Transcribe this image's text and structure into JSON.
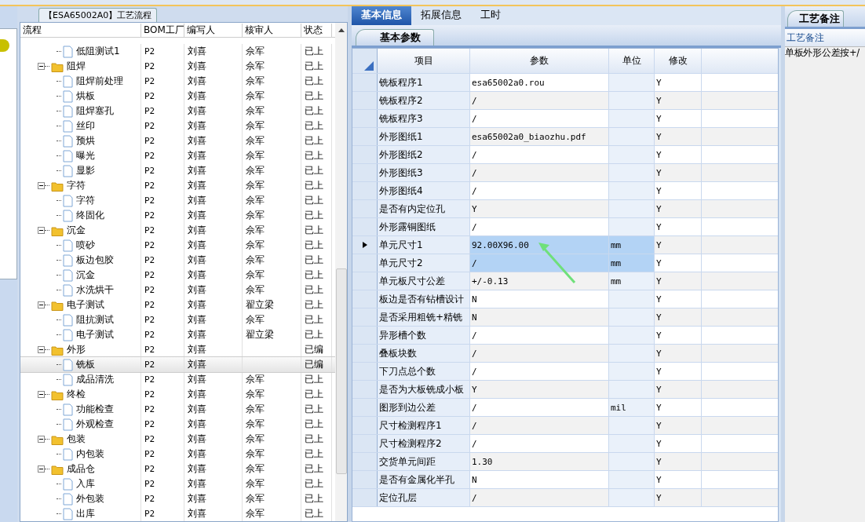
{
  "flow_panel": {
    "title": "【ESA65002A0】工艺流程",
    "columns": [
      "流程",
      "BOM工厂",
      "编写人",
      "核审人",
      "状态"
    ],
    "rows": [
      {
        "kind": "leaf",
        "name": "低阻测试1",
        "factory": "P2",
        "author": "刘喜",
        "reviewer": "佘军",
        "status": "已上",
        "selected": false
      },
      {
        "kind": "group",
        "name": "阻焊",
        "factory": "P2",
        "author": "刘喜",
        "reviewer": "佘军",
        "status": "已上",
        "selected": false,
        "expanded": true,
        "children": [
          {
            "kind": "leaf",
            "name": "阻焊前处理",
            "factory": "P2",
            "author": "刘喜",
            "reviewer": "佘军",
            "status": "已上",
            "selected": false
          },
          {
            "kind": "leaf",
            "name": "烘板",
            "factory": "P2",
            "author": "刘喜",
            "reviewer": "佘军",
            "status": "已上",
            "selected": false
          },
          {
            "kind": "leaf",
            "name": "阻焊塞孔",
            "factory": "P2",
            "author": "刘喜",
            "reviewer": "佘军",
            "status": "已上",
            "selected": false
          },
          {
            "kind": "leaf",
            "name": "丝印",
            "factory": "P2",
            "author": "刘喜",
            "reviewer": "佘军",
            "status": "已上",
            "selected": false
          },
          {
            "kind": "leaf",
            "name": "预烘",
            "factory": "P2",
            "author": "刘喜",
            "reviewer": "佘军",
            "status": "已上",
            "selected": false
          },
          {
            "kind": "leaf",
            "name": "曝光",
            "factory": "P2",
            "author": "刘喜",
            "reviewer": "佘军",
            "status": "已上",
            "selected": false
          },
          {
            "kind": "leaf",
            "name": "显影",
            "factory": "P2",
            "author": "刘喜",
            "reviewer": "佘军",
            "status": "已上",
            "selected": false
          }
        ]
      },
      {
        "kind": "group",
        "name": "字符",
        "factory": "P2",
        "author": "刘喜",
        "reviewer": "佘军",
        "status": "已上",
        "selected": false,
        "expanded": true,
        "children": [
          {
            "kind": "leaf",
            "name": "字符",
            "factory": "P2",
            "author": "刘喜",
            "reviewer": "佘军",
            "status": "已上",
            "selected": false
          },
          {
            "kind": "leaf",
            "name": "终固化",
            "factory": "P2",
            "author": "刘喜",
            "reviewer": "佘军",
            "status": "已上",
            "selected": false
          }
        ]
      },
      {
        "kind": "group",
        "name": "沉金",
        "factory": "P2",
        "author": "刘喜",
        "reviewer": "佘军",
        "status": "已上",
        "selected": false,
        "expanded": true,
        "children": [
          {
            "kind": "leaf",
            "name": "喷砂",
            "factory": "P2",
            "author": "刘喜",
            "reviewer": "佘军",
            "status": "已上",
            "selected": false
          },
          {
            "kind": "leaf",
            "name": "板边包胶",
            "factory": "P2",
            "author": "刘喜",
            "reviewer": "佘军",
            "status": "已上",
            "selected": false
          },
          {
            "kind": "leaf",
            "name": "沉金",
            "factory": "P2",
            "author": "刘喜",
            "reviewer": "佘军",
            "status": "已上",
            "selected": false
          },
          {
            "kind": "leaf",
            "name": "水洗烘干",
            "factory": "P2",
            "author": "刘喜",
            "reviewer": "佘军",
            "status": "已上",
            "selected": false
          }
        ]
      },
      {
        "kind": "group",
        "name": "电子测试",
        "factory": "P2",
        "author": "刘喜",
        "reviewer": "翟立梁",
        "status": "已上",
        "selected": false,
        "expanded": true,
        "children": [
          {
            "kind": "leaf",
            "name": "阻抗测试",
            "factory": "P2",
            "author": "刘喜",
            "reviewer": "佘军",
            "status": "已上",
            "selected": false
          },
          {
            "kind": "leaf",
            "name": "电子测试",
            "factory": "P2",
            "author": "刘喜",
            "reviewer": "翟立梁",
            "status": "已上",
            "selected": false
          }
        ]
      },
      {
        "kind": "group",
        "name": "外形",
        "factory": "P2",
        "author": "刘喜",
        "status": "已编",
        "selected": false,
        "expanded": true,
        "children": [
          {
            "kind": "leaf",
            "name": "铣板",
            "factory": "P2",
            "author": "刘喜",
            "status": "已编",
            "selected": true
          },
          {
            "kind": "leaf",
            "name": "成品清洗",
            "factory": "P2",
            "author": "刘喜",
            "reviewer": "佘军",
            "status": "已上",
            "selected": false
          }
        ]
      },
      {
        "kind": "group",
        "name": "终检",
        "factory": "P2",
        "author": "刘喜",
        "reviewer": "佘军",
        "status": "已上",
        "selected": false,
        "expanded": true,
        "children": [
          {
            "kind": "leaf",
            "name": "功能检查",
            "factory": "P2",
            "author": "刘喜",
            "reviewer": "佘军",
            "status": "已上",
            "selected": false
          },
          {
            "kind": "leaf",
            "name": "外观检查",
            "factory": "P2",
            "author": "刘喜",
            "reviewer": "佘军",
            "status": "已上",
            "selected": false
          }
        ]
      },
      {
        "kind": "group",
        "name": "包装",
        "factory": "P2",
        "author": "刘喜",
        "reviewer": "佘军",
        "status": "已上",
        "selected": false,
        "expanded": true,
        "children": [
          {
            "kind": "leaf",
            "name": "内包装",
            "factory": "P2",
            "author": "刘喜",
            "reviewer": "佘军",
            "status": "已上",
            "selected": false
          }
        ]
      },
      {
        "kind": "group",
        "name": "成品仓",
        "factory": "P2",
        "author": "刘喜",
        "reviewer": "佘军",
        "status": "已上",
        "selected": false,
        "expanded": true,
        "children": [
          {
            "kind": "leaf",
            "name": "入库",
            "factory": "P2",
            "author": "刘喜",
            "reviewer": "佘军",
            "status": "已上",
            "selected": false
          },
          {
            "kind": "leaf",
            "name": "外包装",
            "factory": "P2",
            "author": "刘喜",
            "reviewer": "佘军",
            "status": "已上",
            "selected": false
          },
          {
            "kind": "leaf",
            "name": "出库",
            "factory": "P2",
            "author": "刘喜",
            "reviewer": "佘军",
            "status": "已上",
            "selected": false
          }
        ]
      }
    ]
  },
  "tabs": [
    {
      "label": "基本信息",
      "selected": true
    },
    {
      "label": "拓展信息",
      "selected": false
    },
    {
      "label": "工时",
      "selected": false
    }
  ],
  "sub_tab": "基本参数",
  "params": {
    "columns": [
      "项目",
      "参数",
      "单位",
      "修改"
    ],
    "rows": [
      {
        "item": "铣板程序1",
        "value": "esa65002a0.rou",
        "modified": "Y",
        "selected": false,
        "current": false
      },
      {
        "item": "铣板程序2",
        "value": "/",
        "modified": "Y",
        "selected": false,
        "current": false
      },
      {
        "item": "铣板程序3",
        "value": "/",
        "modified": "Y",
        "selected": false,
        "current": false
      },
      {
        "item": "外形图纸1",
        "value": "esa65002a0_biaozhu.pdf",
        "modified": "Y",
        "selected": false,
        "current": false
      },
      {
        "item": "外形图纸2",
        "value": "/",
        "modified": "Y",
        "selected": false,
        "current": false
      },
      {
        "item": "外形图纸3",
        "value": "/",
        "modified": "Y",
        "selected": false,
        "current": false
      },
      {
        "item": "外形图纸4",
        "value": "/",
        "modified": "Y",
        "selected": false,
        "current": false
      },
      {
        "item": "是否有内定位孔",
        "value": "Y",
        "modified": "Y",
        "selected": false,
        "current": false
      },
      {
        "item": "外形露铜图纸",
        "value": "/",
        "modified": "Y",
        "selected": false,
        "current": false
      },
      {
        "item": "单元尺寸1",
        "value": "92.00X96.00",
        "unit": "mm",
        "modified": "Y",
        "selected": true,
        "current": true
      },
      {
        "item": "单元尺寸2",
        "value": "/",
        "unit": "mm",
        "modified": "Y",
        "selected": true,
        "current": false
      },
      {
        "item": "单元板尺寸公差",
        "value": "+/-0.13",
        "unit": "mm",
        "modified": "Y",
        "selected": false,
        "current": false
      },
      {
        "item": "板边是否有钻槽设计",
        "value": "N",
        "modified": "Y",
        "selected": false,
        "current": false
      },
      {
        "item": "是否采用粗铣+精铣",
        "value": "N",
        "modified": "Y",
        "selected": false,
        "current": false
      },
      {
        "item": "异形槽个数",
        "value": "/",
        "modified": "Y",
        "selected": false,
        "current": false
      },
      {
        "item": "叠板块数",
        "value": "/",
        "modified": "Y",
        "selected": false,
        "current": false
      },
      {
        "item": "下刀点总个数",
        "value": "/",
        "modified": "Y",
        "selected": false,
        "current": false
      },
      {
        "item": "是否为大板铣成小板",
        "value": "Y",
        "modified": "Y",
        "selected": false,
        "current": false
      },
      {
        "item": "图形到边公差",
        "value": "/",
        "unit": "mil",
        "modified": "Y",
        "selected": false,
        "current": false
      },
      {
        "item": "尺寸检测程序1",
        "value": "/",
        "modified": "Y",
        "selected": false,
        "current": false
      },
      {
        "item": "尺寸检测程序2",
        "value": "/",
        "modified": "Y",
        "selected": false,
        "current": false
      },
      {
        "item": "交货单元间距",
        "value": "1.30",
        "modified": "Y",
        "selected": false,
        "current": false
      },
      {
        "item": "是否有金属化半孔",
        "value": "N",
        "modified": "Y",
        "selected": false,
        "current": false
      },
      {
        "item": "定位孔层",
        "value": "/",
        "modified": "Y",
        "selected": false,
        "current": false
      }
    ]
  },
  "notes_panel": {
    "tab": "工艺备注",
    "header": "工艺备注",
    "text": "单板外形公差按+/"
  }
}
